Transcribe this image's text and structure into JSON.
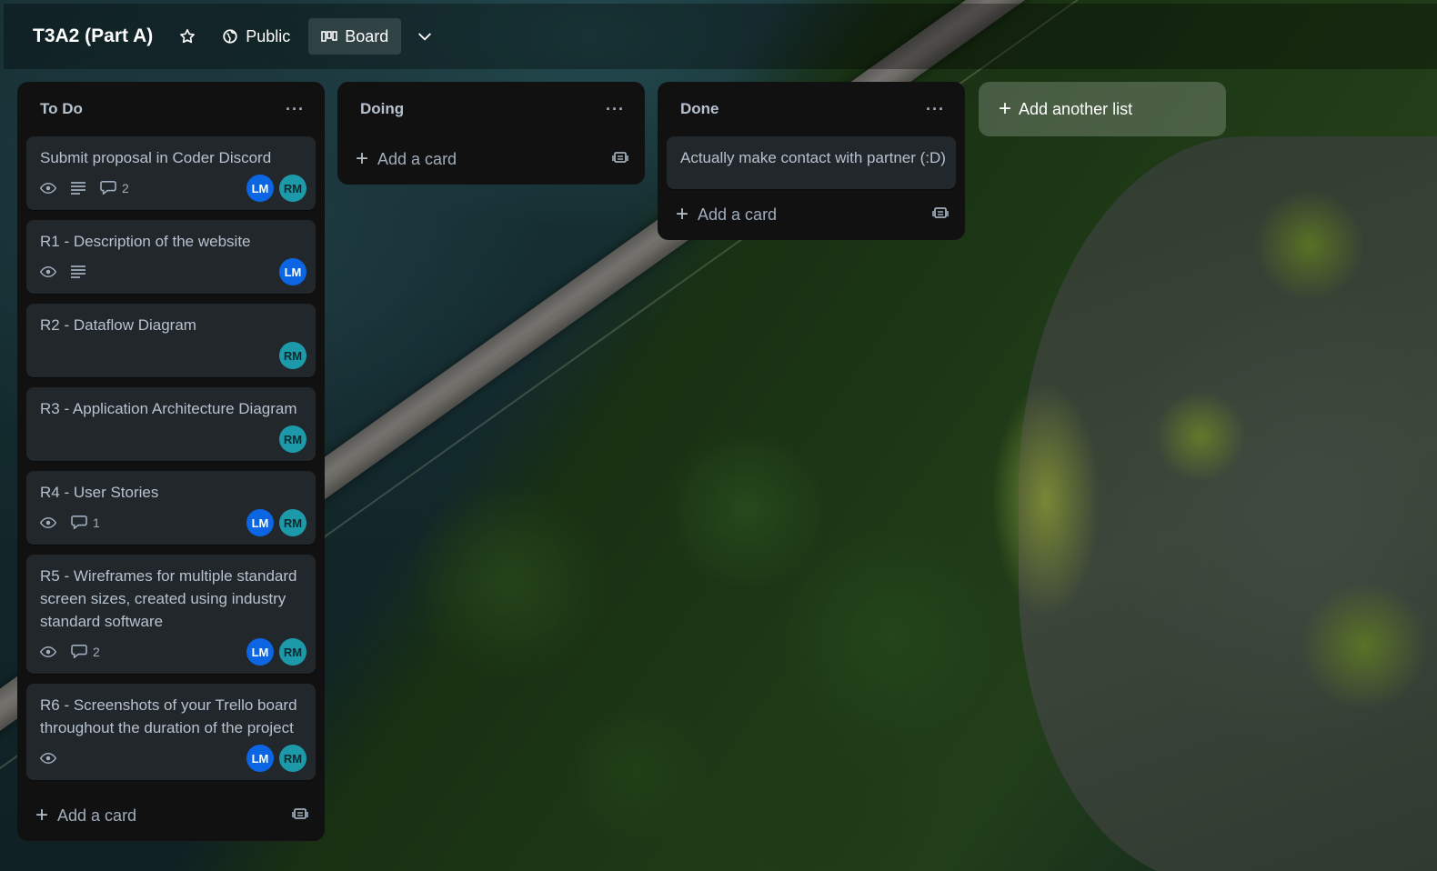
{
  "header": {
    "title": "T3A2 (Part A)",
    "visibility_label": "Public",
    "view_label": "Board"
  },
  "lists": [
    {
      "title": "To Do",
      "menu_label": "···",
      "add_card_label": "Add a card",
      "cards": [
        {
          "title": "Submit proposal in Coder Discord",
          "comments": "2",
          "members": [
            "LM",
            "RM"
          ]
        },
        {
          "title": "R1 - Description of the website",
          "members": [
            "LM"
          ]
        },
        {
          "title": "R2 - Dataflow Diagram",
          "members": [
            "RM"
          ]
        },
        {
          "title": "R3 - Application Architecture Diagram",
          "members": [
            "RM"
          ]
        },
        {
          "title": "R4 - User Stories",
          "comments": "1",
          "members": [
            "LM",
            "RM"
          ]
        },
        {
          "title": "R5 - Wireframes for multiple standard screen sizes, created using industry standard software",
          "comments": "2",
          "members": [
            "LM",
            "RM"
          ]
        },
        {
          "title": "R6 - Screenshots of your Trello board throughout the duration of the project",
          "members": [
            "LM",
            "RM"
          ]
        }
      ]
    },
    {
      "title": "Doing",
      "menu_label": "···",
      "add_card_label": "Add a card",
      "cards": []
    },
    {
      "title": "Done",
      "menu_label": "···",
      "add_card_label": "Add a card",
      "cards": [
        {
          "title": "Actually make contact with partner (:D)"
        }
      ]
    }
  ],
  "add_list_label": "Add another list",
  "colors": {
    "list_bg": "#111111",
    "card_bg": "#22272b",
    "avatar_lm": "#0c66e4",
    "avatar_rm": "#1d9aaa"
  },
  "icons": [
    "star-icon",
    "globe-icon",
    "board-icon",
    "chevron-down-icon",
    "eye-icon",
    "description-icon",
    "comment-icon",
    "template-icon",
    "plus-icon",
    "more-icon"
  ]
}
